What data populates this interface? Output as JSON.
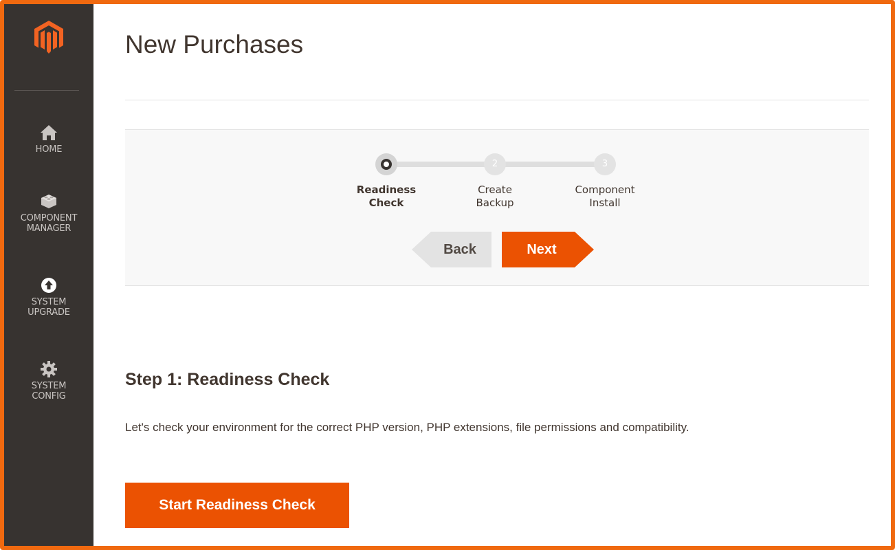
{
  "sidebar": {
    "logo_icon": "magento-logo-icon",
    "items": [
      {
        "label_line1": "HOME",
        "label_line2": "",
        "icon": "home-icon"
      },
      {
        "label_line1": "COMPONENT",
        "label_line2": "MANAGER",
        "icon": "lego-brick-icon"
      },
      {
        "label_line1": "SYSTEM",
        "label_line2": "UPGRADE",
        "icon": "upload-arrow-icon"
      },
      {
        "label_line1": "SYSTEM",
        "label_line2": "CONFIG",
        "icon": "gear-icon"
      }
    ]
  },
  "main": {
    "title": "New Purchases",
    "wizard": {
      "steps": [
        {
          "number": "",
          "label_line1": "Readiness",
          "label_line2": "Check",
          "active": true
        },
        {
          "number": "2",
          "label_line1": "Create",
          "label_line2": "Backup",
          "active": false
        },
        {
          "number": "3",
          "label_line1": "Component",
          "label_line2": "Install",
          "active": false
        }
      ],
      "back_label": "Back",
      "next_label": "Next"
    },
    "step_heading": "Step 1: Readiness Check",
    "step_description": "Let's check your environment for the correct PHP version, PHP extensions, file permissions and compatibility.",
    "start_button_label": "Start Readiness Check"
  },
  "colors": {
    "accent": "#eb5202",
    "frame_border": "#f0690f",
    "sidebar_bg": "#373330"
  }
}
